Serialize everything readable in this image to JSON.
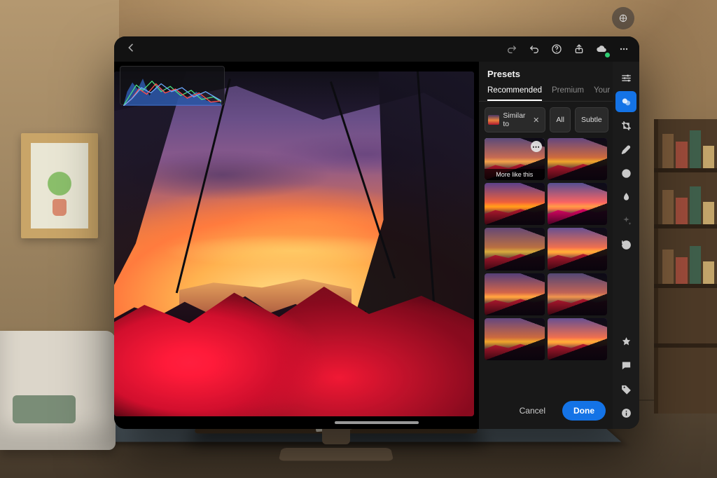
{
  "topbar": {
    "redo_icon": "redo-icon",
    "undo_icon": "undo-icon",
    "help_icon": "help-icon",
    "share_icon": "share-icon",
    "cloud_icon": "cloud-sync-icon",
    "more_icon": "ellipsis-icon"
  },
  "presets": {
    "title": "Presets",
    "tabs": [
      {
        "id": "recommended",
        "label": "Recommended",
        "active": true
      },
      {
        "id": "premium",
        "label": "Premium",
        "active": false
      },
      {
        "id": "yours",
        "label": "Your",
        "active": false
      }
    ],
    "chips": {
      "similar_label": "Similar to",
      "all_label": "All",
      "subtle_label": "Subtle"
    },
    "selected_caption": "More like this",
    "footer": {
      "cancel": "Cancel",
      "done": "Done"
    }
  },
  "tool_rail": [
    {
      "name": "adjust-sliders-icon",
      "active": false
    },
    {
      "name": "presets-icon",
      "active": true
    },
    {
      "name": "crop-icon",
      "active": false
    },
    {
      "name": "healing-brush-icon",
      "active": false
    },
    {
      "name": "radial-mask-icon",
      "active": false
    },
    {
      "name": "dropper-icon",
      "active": false
    },
    {
      "name": "sparkle-icon",
      "active": false,
      "dim": true
    },
    {
      "name": "history-icon",
      "active": false
    }
  ],
  "bottom_rail": [
    {
      "name": "favorite-star-icon"
    },
    {
      "name": "comment-icon"
    },
    {
      "name": "tag-icon"
    },
    {
      "name": "info-icon"
    }
  ],
  "colors": {
    "accent": "#1473e6"
  }
}
